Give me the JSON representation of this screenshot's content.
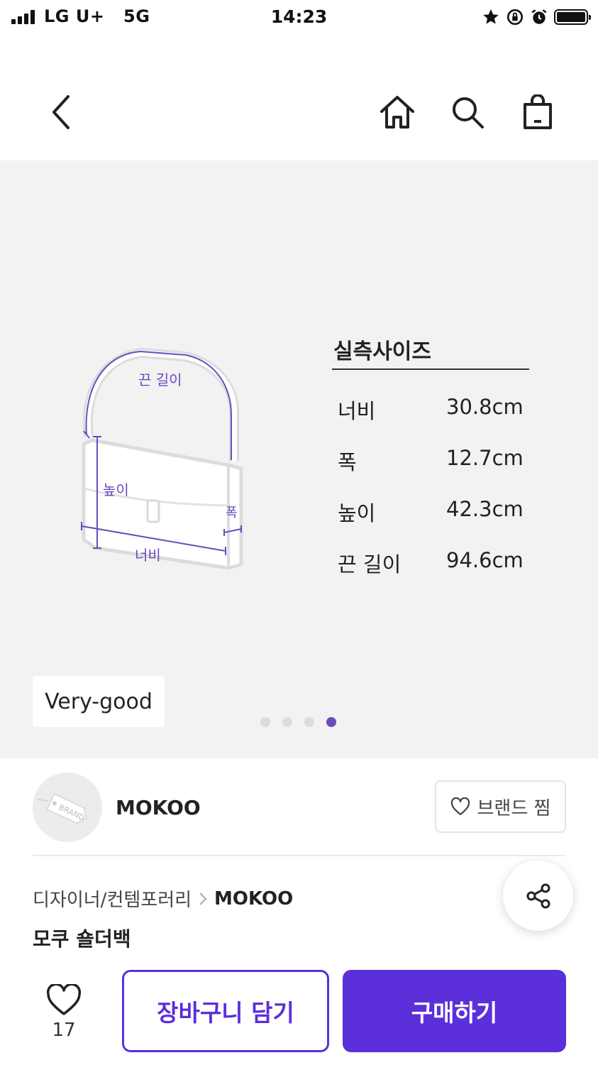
{
  "status_bar": {
    "carrier": "LG U+   5G",
    "time": "14:23",
    "icons": [
      "signal-icon",
      "star-icon",
      "rotation-lock-icon",
      "alarm-icon",
      "battery-icon"
    ]
  },
  "nav": {
    "icons": [
      "back-arrow-icon",
      "home-icon",
      "search-icon",
      "shopping-bag-icon"
    ]
  },
  "gallery": {
    "diagram_labels": {
      "strap": "끈 길이",
      "height": "높이",
      "depth": "폭",
      "width": "너비"
    },
    "size_title": "실측사이즈",
    "sizes": [
      {
        "label": "너비",
        "value": "30.8cm"
      },
      {
        "label": "폭",
        "value": "12.7cm"
      },
      {
        "label": "높이",
        "value": "42.3cm"
      },
      {
        "label": "끈 길이",
        "value": "94.6cm"
      }
    ],
    "grade": "Very-good",
    "slide_count": 4,
    "active_slide": 4,
    "accent_color": "#6a4bbd"
  },
  "brand": {
    "logo_text": "BRAND",
    "name": "MOKOO",
    "like_label": "브랜드 찜"
  },
  "product": {
    "category": "디자이너/컨템포러리",
    "brand": "MOKOO",
    "name": "모쿠 숄더백"
  },
  "bottom": {
    "wish_count": "17",
    "cart_label": "장바구니 담기",
    "buy_label": "구매하기",
    "primary_color": "#5b2fd9"
  }
}
